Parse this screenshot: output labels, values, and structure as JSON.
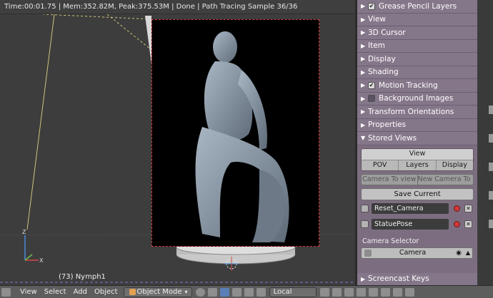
{
  "status_bar": {
    "text": "Time:00:01.75 | Mem:352.82M, Peak:375.53M | Done | Path Tracing Sample 36/36"
  },
  "viewport": {
    "object_label": "(73) Nymph1"
  },
  "panels": [
    {
      "label": "Grease Pencil Layers",
      "checkbox": "checked",
      "icon": "triangle-right-icon"
    },
    {
      "label": "View",
      "checkbox": "none",
      "icon": "triangle-right-icon"
    },
    {
      "label": "3D Cursor",
      "checkbox": "none",
      "icon": "triangle-right-icon"
    },
    {
      "label": "Item",
      "checkbox": "none",
      "icon": "triangle-right-icon"
    },
    {
      "label": "Display",
      "checkbox": "none",
      "icon": "triangle-right-icon"
    },
    {
      "label": "Shading",
      "checkbox": "none",
      "icon": "triangle-right-icon"
    },
    {
      "label": "Motion Tracking",
      "checkbox": "checked",
      "icon": "triangle-right-icon"
    },
    {
      "label": "Background Images",
      "checkbox": "unchecked",
      "icon": "triangle-right-icon"
    },
    {
      "label": "Transform Orientations",
      "checkbox": "none",
      "icon": "triangle-right-icon"
    },
    {
      "label": "Properties",
      "checkbox": "none",
      "icon": "triangle-right-icon"
    }
  ],
  "stored_views": {
    "header": "Stored Views",
    "tab_header": "View",
    "tabs": [
      "POV",
      "Layers",
      "Display"
    ],
    "camera_to_view": "Camera To view",
    "new_camera_to": "New Camera To ...",
    "save_current": "Save Current",
    "cameras": [
      "Reset_Camera",
      "StatuePose"
    ],
    "camera_selector_label": "Camera Selector",
    "camera_selector_value": "Camera"
  },
  "screencast_keys": {
    "label": "Screencast Keys"
  },
  "header_bar": {
    "view": "View",
    "select": "Select",
    "add": "Add",
    "object": "Object",
    "mode": "Object Mode",
    "orientation": "Local"
  },
  "colors": {
    "panel_bg": "#7c6e80",
    "render_border": "#d23a3a",
    "viewport_bg": "#3d3d3d"
  }
}
